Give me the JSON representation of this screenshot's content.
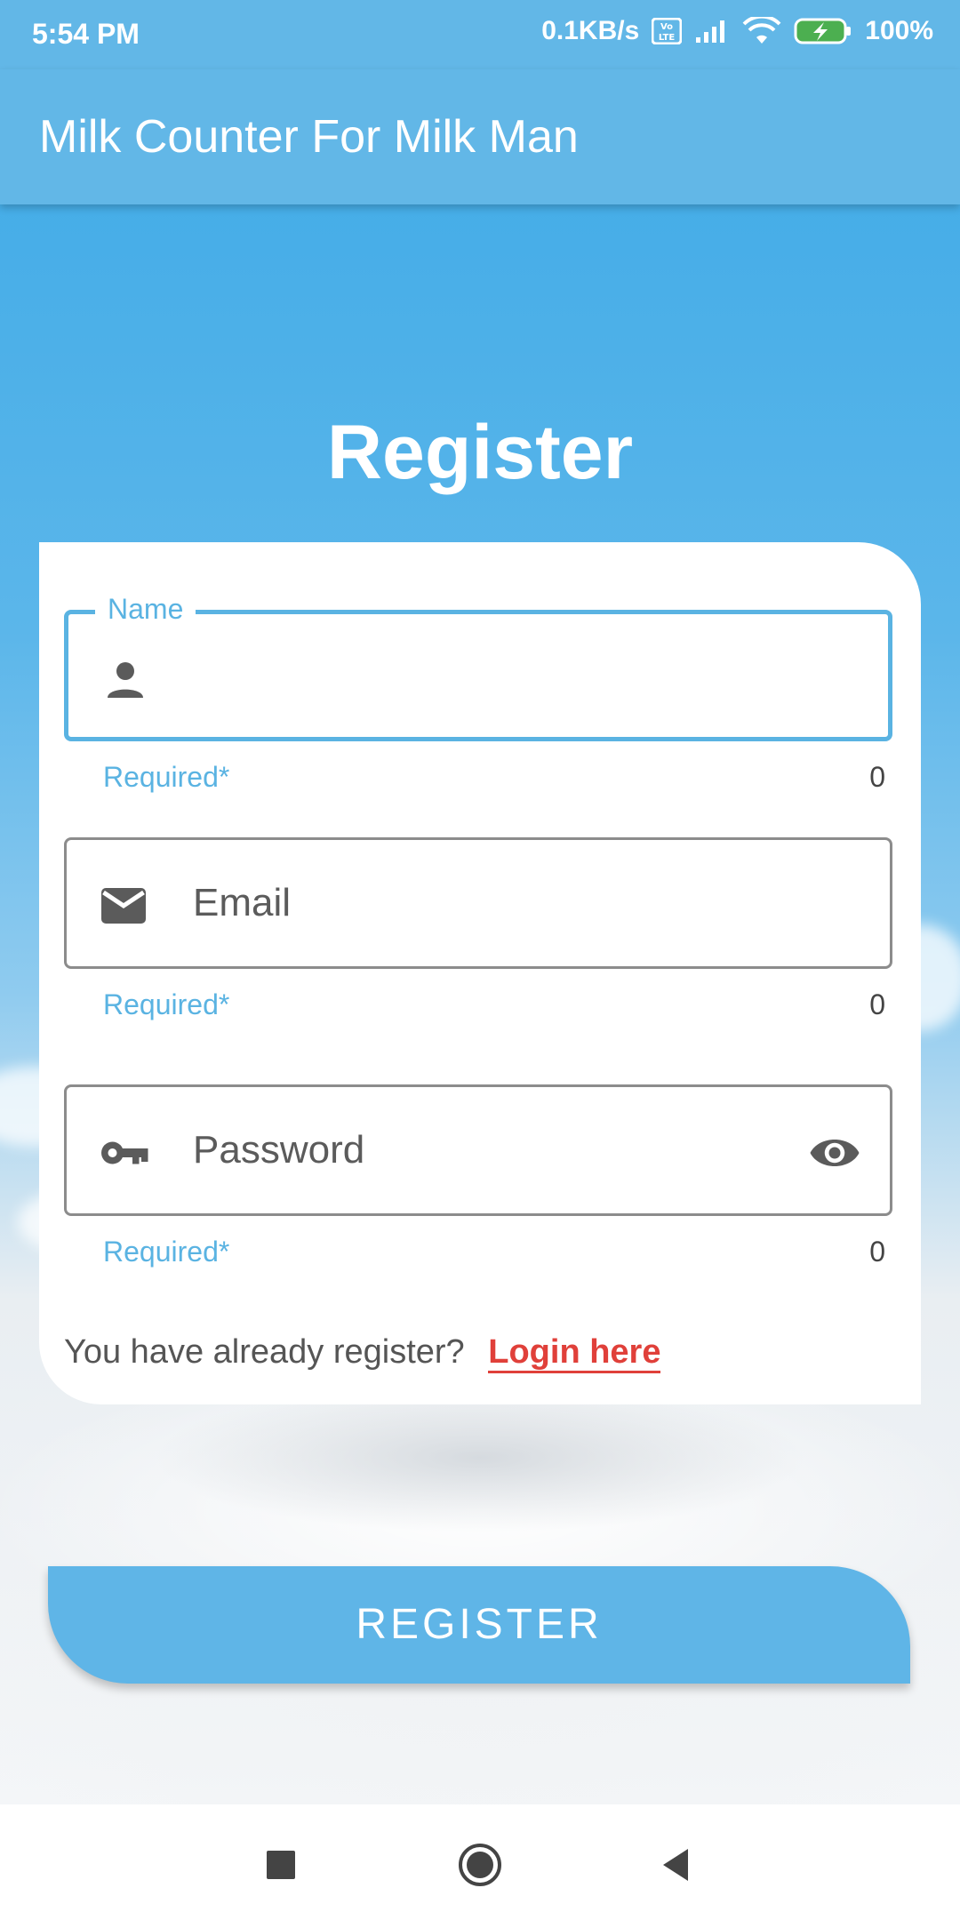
{
  "status_bar": {
    "time": "5:54 PM",
    "net_speed": "0.1KB/s",
    "battery": "100%"
  },
  "app_bar": {
    "title": "Milk Counter For Milk Man"
  },
  "page": {
    "heading": "Register"
  },
  "form": {
    "name": {
      "label": "Name",
      "value": "",
      "helper": "Required*",
      "counter": "0",
      "icon": "person-icon"
    },
    "email": {
      "placeholder": "Email",
      "helper": "Required*",
      "counter": "0",
      "icon": "mail-icon"
    },
    "password": {
      "placeholder": "Password",
      "helper": "Required*",
      "counter": "0",
      "icon": "key-icon",
      "toggle_icon": "eye-icon"
    },
    "login_prompt": "You have already register?",
    "login_link": "Login here"
  },
  "actions": {
    "register_label": "REGISTER"
  },
  "colors": {
    "accent": "#5fb5e7",
    "link": "#e0403a"
  }
}
